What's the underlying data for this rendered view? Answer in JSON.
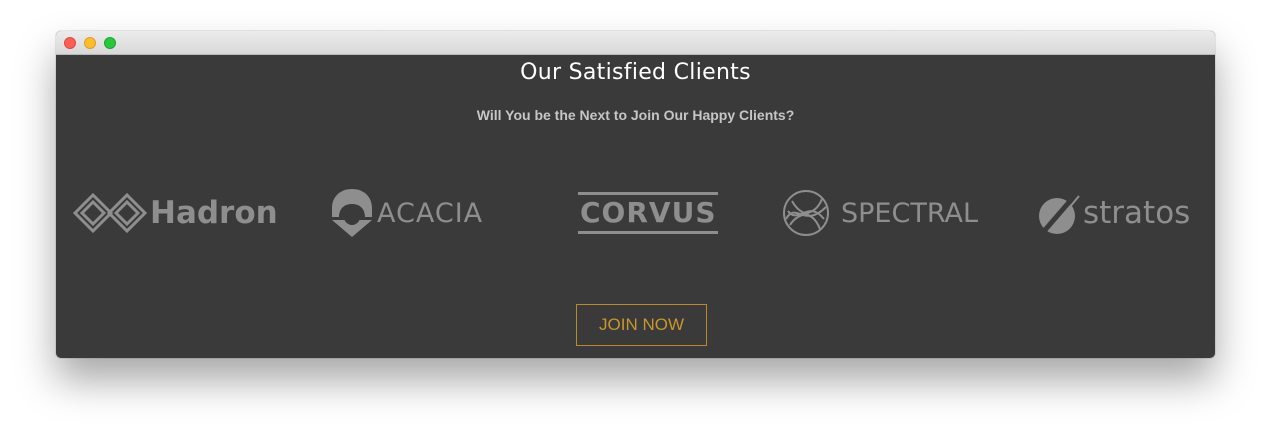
{
  "window": {
    "controls": [
      "close",
      "minimize",
      "zoom"
    ]
  },
  "section": {
    "title": "Our Satisfied Clients",
    "subtitle": "Will You be the Next to Join Our Happy Clients?"
  },
  "clients": [
    {
      "name": "Hadron",
      "icon": "hadron-logo-icon"
    },
    {
      "name": "ACACIA",
      "icon": "acacia-logo-icon"
    },
    {
      "name": "CORVUS",
      "icon": "corvus-logo"
    },
    {
      "name": "SPECTRAL",
      "icon": "spectral-logo-icon"
    },
    {
      "name": "stratos",
      "icon": "stratos-logo-icon"
    }
  ],
  "cta": {
    "label": "JOIN NOW"
  },
  "colors": {
    "background": "#3a3a3a",
    "logo": "#8e8e8e",
    "accent": "#c8962c",
    "title": "#ffffff",
    "subtitle": "#c6c6c6"
  }
}
